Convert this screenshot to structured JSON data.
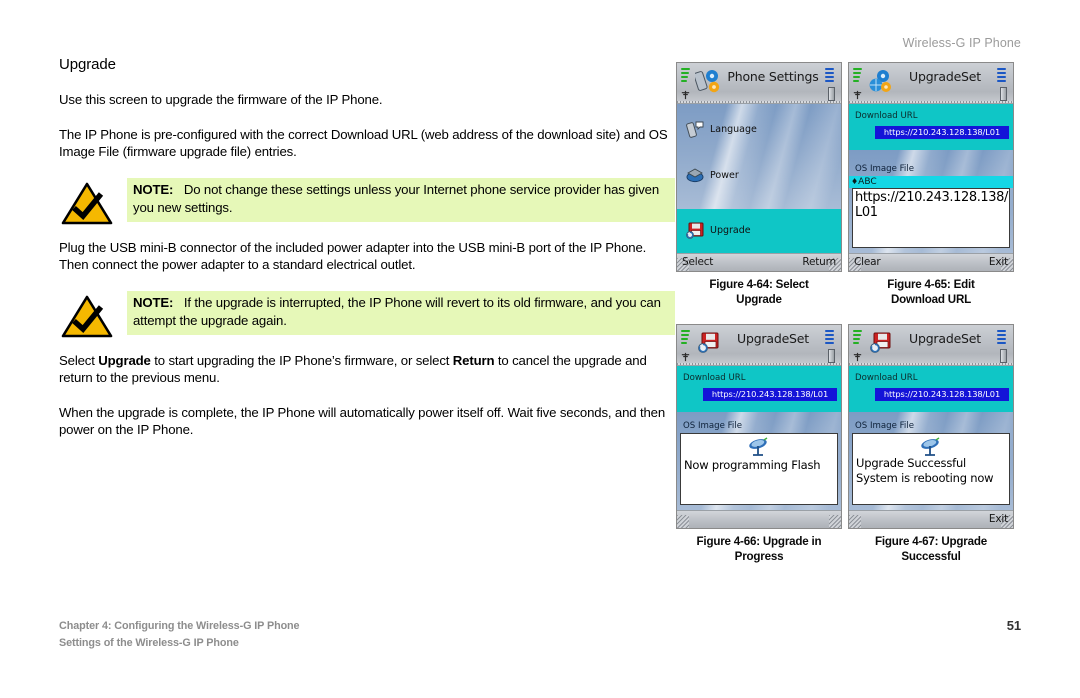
{
  "running_head": "Wireless-G IP Phone",
  "section": {
    "title": "Upgrade",
    "p1": "Use this screen to upgrade the firmware of the IP Phone.",
    "p2": "The IP Phone is pre-configured with the correct Download URL (web address of the download site) and OS Image File (firmware upgrade file) entries.",
    "note1_label": "NOTE:",
    "note1_text": "Do not change these settings unless your Internet phone service provider has given you new settings.",
    "p3": "Plug the USB mini-B connector of the included power adapter into the USB mini-B port of the IP Phone. Then connect the power adapter to a standard electrical outlet.",
    "note2_label": "NOTE:",
    "note2_text": "If the upgrade is interrupted, the IP Phone will revert to its old firmware, and you can attempt the upgrade again.",
    "p4_a": "Select ",
    "p4_b": "Upgrade",
    "p4_c": " to start upgrading the IP Phone’s firmware, or select ",
    "p4_d": "Return",
    "p4_e": " to cancel the upgrade and return to the previous menu.",
    "p5": "When the upgrade is complete, the IP Phone will automatically power itself off. Wait five seconds, and then power on the IP Phone."
  },
  "figures": [
    {
      "id": "fig-4-64",
      "caption_line1": "Figure 4-64: Select",
      "caption_line2": "Upgrade",
      "screen": {
        "title": "Phone Settings",
        "menu": [
          {
            "label": "Language",
            "selected": false
          },
          {
            "label": "Power",
            "selected": false
          },
          {
            "label": "Upgrade",
            "selected": true
          }
        ],
        "softkey_left": "Select",
        "softkey_right": "Return"
      }
    },
    {
      "id": "fig-4-65",
      "caption_line1": "Figure 4-65: Edit",
      "caption_line2": "Download URL",
      "screen": {
        "title": "UpgradeSet",
        "field1_label": "Download URL",
        "field1_value": "https://210.243.128.138/L01",
        "field2_label": "OS Image File",
        "ime_mode": "ABC",
        "edit_value": "https://210.243.128.138/L01",
        "softkey_left": "Clear",
        "softkey_right": "Exit"
      }
    },
    {
      "id": "fig-4-66",
      "caption_line1": "Figure 4-66: Upgrade in",
      "caption_line2": "Progress",
      "screen": {
        "title": "UpgradeSet",
        "field1_label": "Download URL",
        "field1_value": "https://210.243.128.138/L01",
        "field2_label": "OS Image File",
        "message_line1": "Now programming Flash",
        "message_line2": "",
        "softkey_left": "",
        "softkey_right": ""
      }
    },
    {
      "id": "fig-4-67",
      "caption_line1": "Figure 4-67: Upgrade",
      "caption_line2": "Successful",
      "screen": {
        "title": "UpgradeSet",
        "field1_label": "Download URL",
        "field1_value": "https://210.243.128.138/L01",
        "field2_label": "OS Image File",
        "message_line1": "Upgrade Successful",
        "message_line2": "System is rebooting now",
        "softkey_left": "",
        "softkey_right": "Exit"
      }
    }
  ],
  "footer": {
    "line1": "Chapter 4: Configuring the Wireless-G IP Phone",
    "line2": "Settings of the Wireless-G IP Phone",
    "page": "51"
  },
  "colors": {
    "note_highlight": "#e6f8b8",
    "note_triangle": "#f5b800",
    "lcd_teal": "#0fc6c6",
    "url_chip": "#1414d8",
    "signal_green": "#24b024",
    "footer_gray": "#8d8d8d"
  }
}
